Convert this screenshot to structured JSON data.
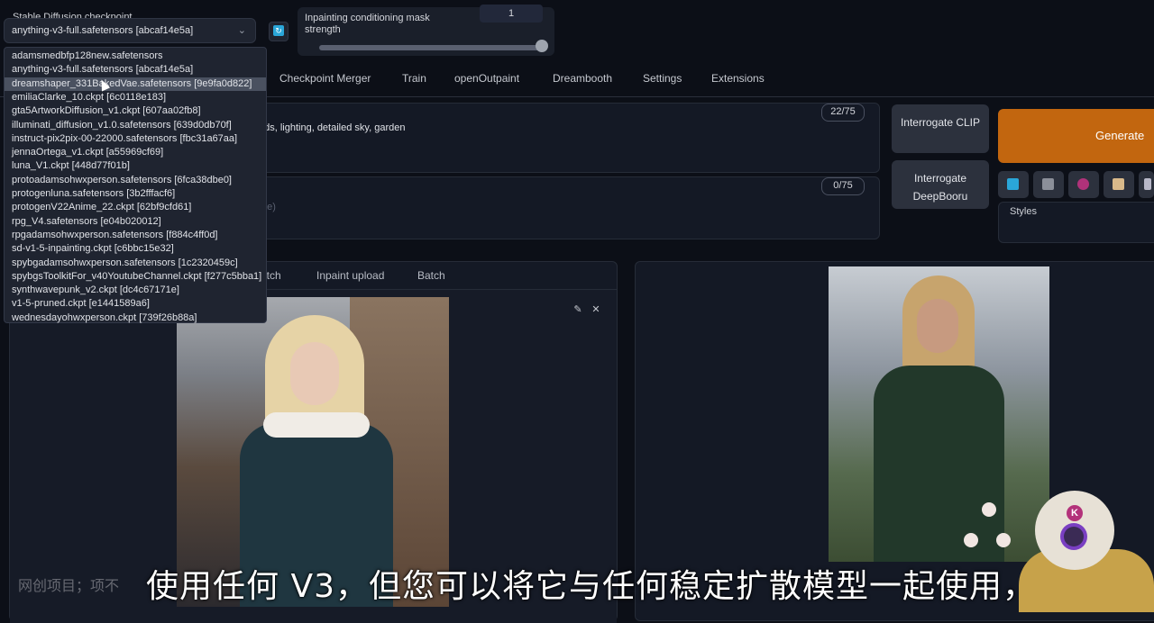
{
  "checkpoint": {
    "label": "Stable Diffusion checkpoint",
    "value": "anything-v3-full.safetensors [abcaf14e5a]",
    "options": [
      "adamsmedbfp128new.safetensors",
      "anything-v3-full.safetensors [abcaf14e5a]",
      "dreamshaper_331BakedVae.safetensors [9e9fa0d822]",
      "emiliaClarke_10.ckpt [6c0118e183]",
      "gta5ArtworkDiffusion_v1.ckpt [607aa02fb8]",
      "illuminati_diffusion_v1.0.safetensors [639d0db70f]",
      "instruct-pix2pix-00-22000.safetensors [fbc31a67aa]",
      "jennaOrtega_v1.ckpt [a55969cf69]",
      "luna_V1.ckpt [448d77f01b]",
      "protoadamsohwxperson.safetensors [6fca38dbe0]",
      "protogenluna.safetensors [3b2fffacf6]",
      "protogenV22Anime_22.ckpt [62bf9cfd61]",
      "rpg_V4.safetensors [e04b020012]",
      "rpgadamsohwxperson.safetensors [f884c4ff0d]",
      "sd-v1-5-inpainting.ckpt [c6bbc15e32]",
      "spybgadamsohwxperson.safetensors [1c2320459c]",
      "spybgsToolkitFor_v40YoutubeChannel.ckpt [f277c5bba1]",
      "synthwavepunk_v2.ckpt [dc4c67171e]",
      "v1-5-pruned.ckpt [e1441589a6]",
      "wednesdayohwxperson.ckpt [739f26b88a]"
    ],
    "highlighted_index": 2
  },
  "mask_strength": {
    "label": "Inpainting conditioning mask strength",
    "value": "1",
    "level": 1.0
  },
  "tabs": [
    "Checkpoint Merger",
    "Train",
    "openOutpaint",
    "Dreambooth",
    "Settings",
    "Extensions"
  ],
  "prompt": {
    "text": "uds, lighting, detailed sky, garden",
    "tokens": "22/75"
  },
  "negative": {
    "placeholder": "ate)",
    "tokens": "0/75"
  },
  "interrogate_clip": "Interrogate CLIP",
  "interrogate_deepbooru": "Interrogate DeepBooru",
  "generate": "Generate",
  "styles_label": "Styles",
  "subtabs": [
    "etch",
    "Inpaint upload",
    "Batch"
  ],
  "subtitle": "使用任何 V3，但您可以将它与任何稳定扩散模型一起使用，",
  "watermark": "网创项目；项不",
  "avatar_letter": "K",
  "colors": {
    "accent": "#c2660f",
    "checkbox": "#2aa6d8"
  }
}
